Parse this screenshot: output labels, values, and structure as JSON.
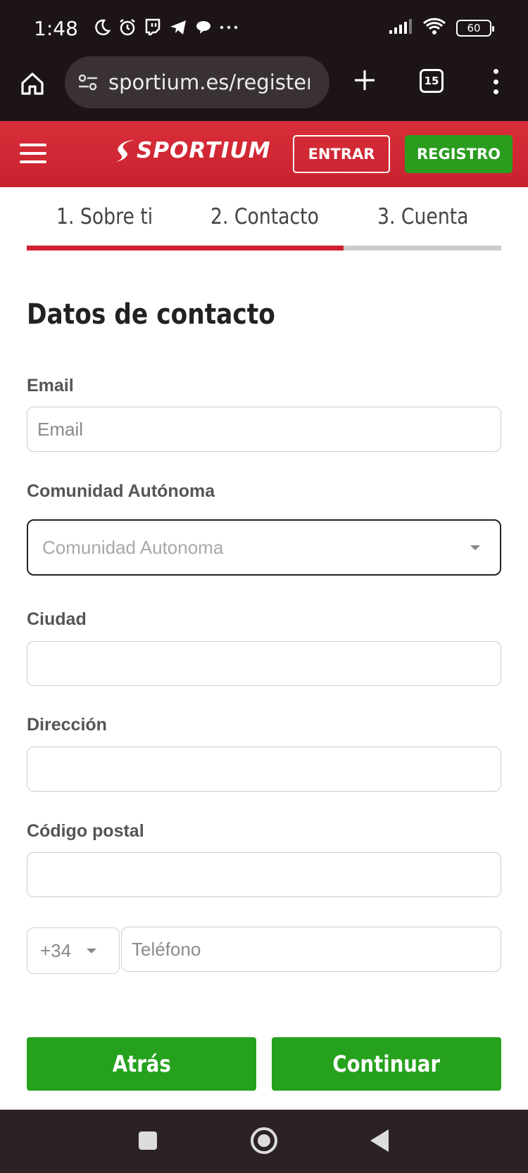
{
  "status_bar": {
    "time": "1:48",
    "battery": "60",
    "icons_left": [
      "moon-icon",
      "alarm-icon",
      "twitch-icon",
      "telegram-icon",
      "chat-icon",
      "more-dots-icon"
    ],
    "icons_right": [
      "signal-icon",
      "wifi-icon",
      "battery-icon"
    ]
  },
  "browser": {
    "url": "sportium.es/register",
    "tabs_count": "15"
  },
  "header": {
    "logo": "SPORTIUM",
    "login_label": "ENTRAR",
    "register_label": "REGISTRO",
    "brand_red": "#d0202e",
    "brand_green": "#26a11d"
  },
  "steps": {
    "items": [
      "1. Sobre ti",
      "2. Contacto",
      "3. Cuenta"
    ],
    "current": 2,
    "progress_fraction": 0.667
  },
  "form": {
    "title": "Datos de contacto",
    "email": {
      "label": "Email",
      "placeholder": "Email",
      "value": ""
    },
    "region": {
      "label": "Comunidad Autónoma",
      "selected": "Comunidad Autonoma"
    },
    "city": {
      "label": "Ciudad",
      "value": ""
    },
    "address": {
      "label": "Dirección",
      "value": ""
    },
    "postal_code": {
      "label": "Código postal",
      "value": ""
    },
    "phone": {
      "prefix": "+34",
      "placeholder": "Teléfono",
      "value": ""
    }
  },
  "actions": {
    "back_label": "Atrás",
    "continue_label": "Continuar"
  }
}
